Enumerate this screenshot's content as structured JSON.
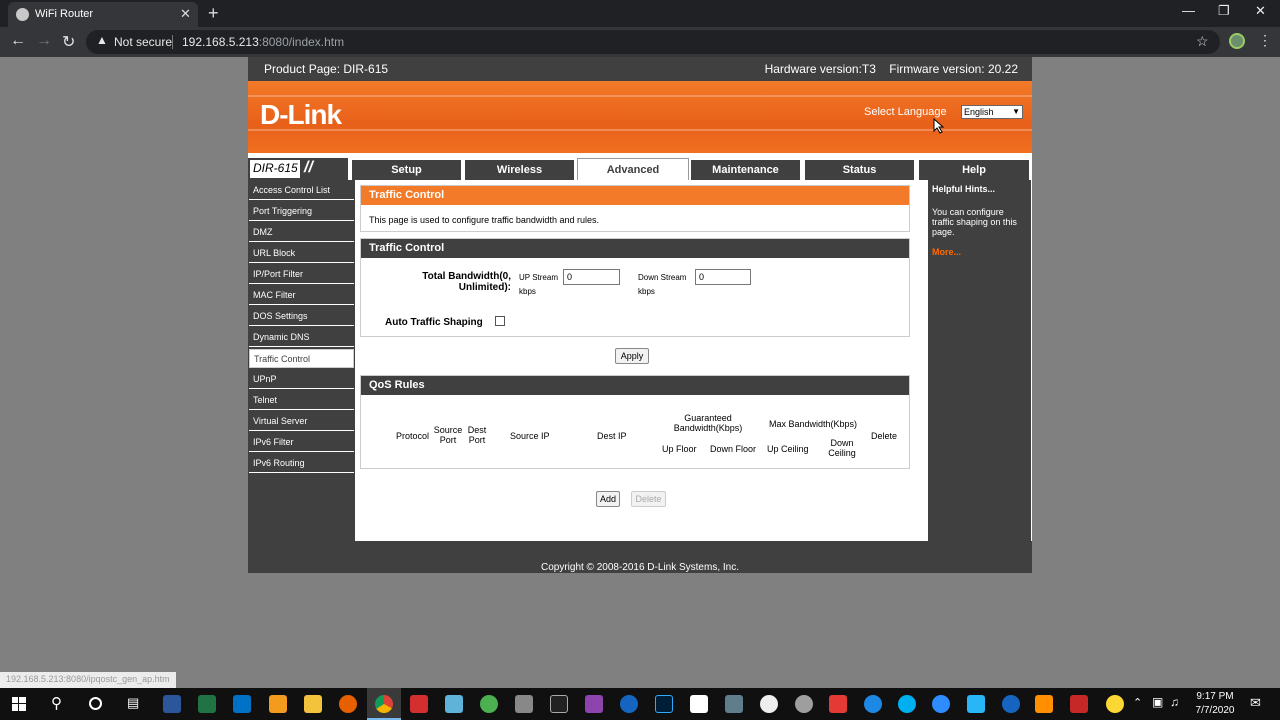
{
  "browser": {
    "tab_title": "WiFi Router",
    "tab_close": "✕",
    "new_tab": "+",
    "security_text": "Not secure",
    "url_host": "192.168.5.213",
    "url_rest": ":8080/index.htm",
    "status_url": "192.168.5.213:8080/ipqostc_gen_ap.htm"
  },
  "router": {
    "product_page": "Product Page: DIR-615",
    "hardware": "Hardware version:T3",
    "firmware": "Firmware version: 20.22",
    "logo": "D-Link",
    "select_language": "Select Language",
    "language": "English",
    "model": "DIR-615",
    "top_tabs": [
      "Setup",
      "Wireless",
      "Advanced",
      "Maintenance",
      "Status",
      "Help"
    ],
    "active_tab": "Advanced",
    "left_nav": [
      "Access Control List",
      "Port Triggering",
      "DMZ",
      "URL Block",
      "IP/Port Filter",
      "MAC Filter",
      "DOS Settings",
      "Dynamic DNS",
      "Traffic Control",
      "UPnP",
      "Telnet",
      "Virtual Server",
      "IPv6 Filter",
      "IPv6 Routing"
    ],
    "active_nav": "Traffic Control",
    "intro": {
      "title": "Traffic Control",
      "text": "This page is used to configure traffic bandwidth and rules."
    },
    "traffic": {
      "title": "Traffic Control",
      "total_bandwidth_line1": "Total Bandwidth(0,",
      "total_bandwidth_line2": "Unlimited):",
      "up_stream_label": "UP Stream",
      "up_stream_value": "0",
      "down_stream_label": "Down Stream",
      "down_stream_value": "0",
      "unit": "kbps",
      "auto_shaping": "Auto Traffic Shaping",
      "apply": "Apply"
    },
    "qos": {
      "title": "QoS Rules",
      "col_protocol": "Protocol",
      "col_source_port": [
        "Source",
        "Port"
      ],
      "col_dest_port": [
        "Dest",
        "Port"
      ],
      "col_source_ip": "Source IP",
      "col_dest_ip": "Dest IP",
      "col_guaranteed": [
        "Guaranteed",
        "Bandwidth(Kbps)"
      ],
      "col_max": "Max Bandwidth(Kbps)",
      "col_up_floor": "Up Floor",
      "col_down_floor": "Down Floor",
      "col_up_ceiling": "Up Ceiling",
      "col_down_ceiling": [
        "Down",
        "Ceiling"
      ],
      "col_delete": "Delete",
      "add": "Add",
      "delete": "Delete"
    },
    "hints": {
      "title": "Helpful Hints...",
      "text": "You can configure traffic shaping on this page.",
      "more": "More..."
    },
    "copyright": "Copyright © 2008-2016 D-Link Systems, Inc."
  },
  "taskbar": {
    "time": "9:17 PM",
    "date": "7/7/2020"
  }
}
